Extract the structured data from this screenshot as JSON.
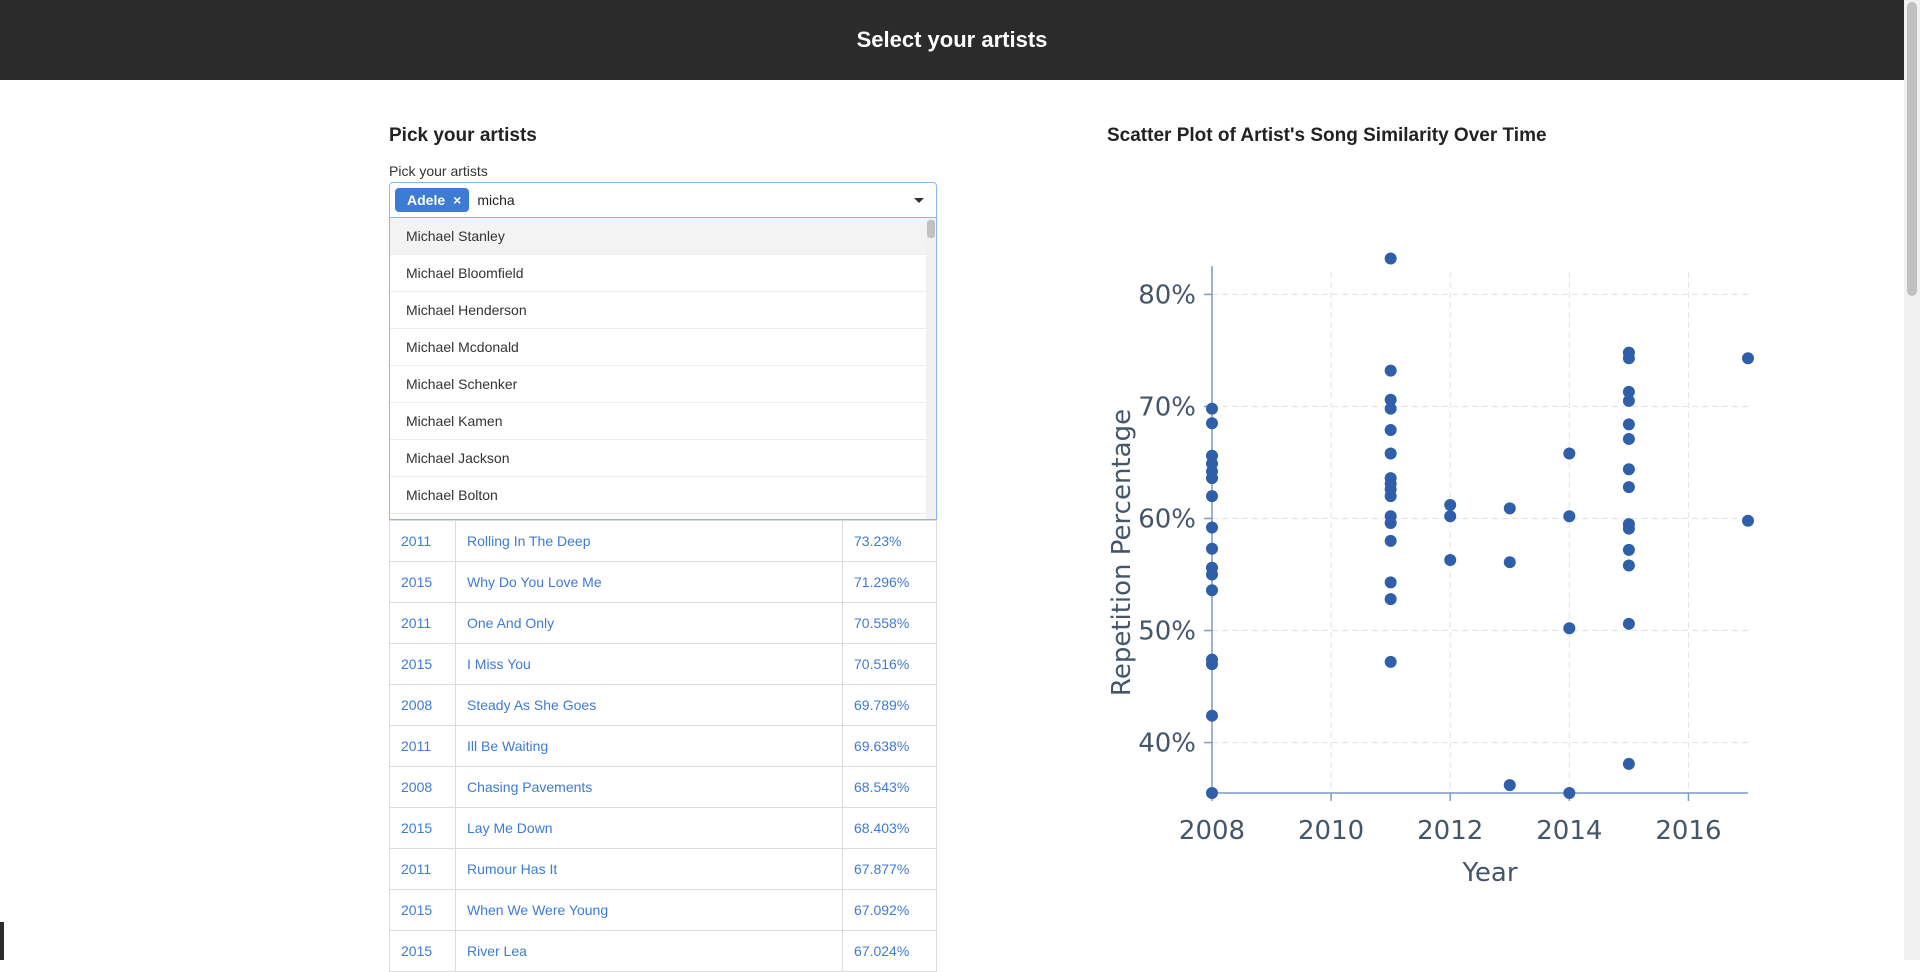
{
  "header": {
    "title": "Select your artists"
  },
  "left": {
    "section_title": "Pick your artists",
    "field_label": "Pick your artists",
    "chip_label": "Adele",
    "chip_remove": "×",
    "search_value": "micha",
    "options": [
      "Michael Stanley",
      "Michael Bloomfield",
      "Michael Henderson",
      "Michael Mcdonald",
      "Michael Schenker",
      "Michael Kamen",
      "Michael Jackson",
      "Michael Bolton"
    ]
  },
  "table": {
    "rows": [
      {
        "year": "2011",
        "song": "Rolling In The Deep",
        "pct": "73.23%"
      },
      {
        "year": "2015",
        "song": "Why Do You Love Me",
        "pct": "71.296%"
      },
      {
        "year": "2011",
        "song": "One And Only",
        "pct": "70.558%"
      },
      {
        "year": "2015",
        "song": "I Miss You",
        "pct": "70.516%"
      },
      {
        "year": "2008",
        "song": "Steady As She Goes",
        "pct": "69.789%"
      },
      {
        "year": "2011",
        "song": "Ill Be Waiting",
        "pct": "69.638%"
      },
      {
        "year": "2008",
        "song": "Chasing Pavements",
        "pct": "68.543%"
      },
      {
        "year": "2015",
        "song": "Lay Me Down",
        "pct": "68.403%"
      },
      {
        "year": "2011",
        "song": "Rumour Has It",
        "pct": "67.877%"
      },
      {
        "year": "2015",
        "song": "When We Were Young",
        "pct": "67.092%"
      },
      {
        "year": "2015",
        "song": "River Lea",
        "pct": "67.024%"
      }
    ]
  },
  "right": {
    "section_title": "Scatter Plot of Artist's Song Similarity Over Time"
  },
  "colors": {
    "accent": "#3e7bd4",
    "marker": "#2f5fa8",
    "header_bg": "#2b2b2b"
  },
  "chart_data": {
    "type": "scatter",
    "xlabel": "Year",
    "ylabel": "Repetition Percentage",
    "xlim": [
      2008,
      2017
    ],
    "ylim": [
      35.5,
      82
    ],
    "x_ticks": [
      2008,
      2010,
      2012,
      2014,
      2016
    ],
    "y_ticks": [
      40,
      50,
      60,
      70,
      80
    ],
    "y_tick_labels": [
      "40%",
      "50%",
      "60%",
      "70%",
      "80%"
    ],
    "grid": true,
    "points": [
      [
        2008,
        69.8
      ],
      [
        2008,
        68.5
      ],
      [
        2008,
        65.6
      ],
      [
        2008,
        64.9
      ],
      [
        2008,
        64.2
      ],
      [
        2008,
        63.6
      ],
      [
        2008,
        62.0
      ],
      [
        2008,
        59.2
      ],
      [
        2008,
        57.3
      ],
      [
        2008,
        55.6
      ],
      [
        2008,
        55.0
      ],
      [
        2008,
        53.6
      ],
      [
        2008,
        47.4
      ],
      [
        2008,
        47.0
      ],
      [
        2008,
        42.4
      ],
      [
        2008,
        35.5
      ],
      [
        2011,
        83.2
      ],
      [
        2011,
        73.2
      ],
      [
        2011,
        70.6
      ],
      [
        2011,
        69.8
      ],
      [
        2011,
        67.9
      ],
      [
        2011,
        65.8
      ],
      [
        2011,
        63.6
      ],
      [
        2011,
        63.1
      ],
      [
        2011,
        62.6
      ],
      [
        2011,
        62.0
      ],
      [
        2011,
        60.2
      ],
      [
        2011,
        59.6
      ],
      [
        2011,
        58.0
      ],
      [
        2011,
        54.3
      ],
      [
        2011,
        52.8
      ],
      [
        2011,
        47.2
      ],
      [
        2012,
        61.2
      ],
      [
        2012,
        60.2
      ],
      [
        2012,
        56.3
      ],
      [
        2013,
        60.9
      ],
      [
        2013,
        56.1
      ],
      [
        2013,
        36.2
      ],
      [
        2014,
        65.8
      ],
      [
        2014,
        60.2
      ],
      [
        2014,
        50.2
      ],
      [
        2014,
        35.5
      ],
      [
        2015,
        74.8
      ],
      [
        2015,
        74.3
      ],
      [
        2015,
        71.3
      ],
      [
        2015,
        70.5
      ],
      [
        2015,
        68.4
      ],
      [
        2015,
        67.1
      ],
      [
        2015,
        64.4
      ],
      [
        2015,
        62.8
      ],
      [
        2015,
        59.5
      ],
      [
        2015,
        59.1
      ],
      [
        2015,
        57.2
      ],
      [
        2015,
        55.8
      ],
      [
        2015,
        50.6
      ],
      [
        2015,
        38.1
      ],
      [
        2017,
        74.3
      ],
      [
        2017,
        59.8
      ]
    ]
  }
}
